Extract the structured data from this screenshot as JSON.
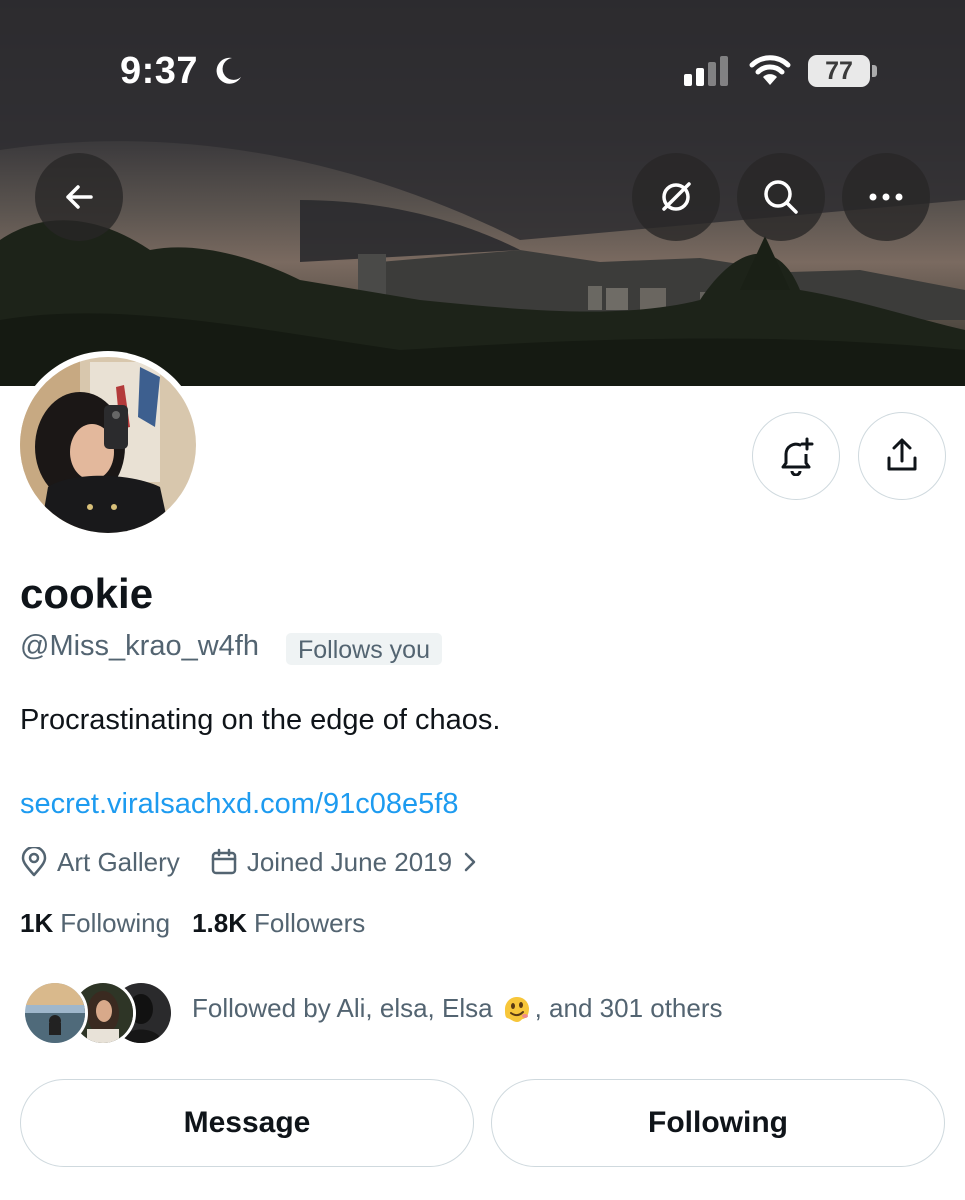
{
  "status_bar": {
    "time": "9:37",
    "battery": "77"
  },
  "header": {
    "icons": [
      "back-arrow-icon",
      "grok-icon",
      "search-icon",
      "more-icon"
    ]
  },
  "profile": {
    "display_name": "cookie",
    "handle": "@Miss_krao_w4fh",
    "follows_you_label": "Follows you",
    "bio": "Procrastinating on the edge of chaos.",
    "link": "secret.viralsachxd.com/91c08e5f8",
    "location": "Art Gallery",
    "joined": "Joined June 2019",
    "following_count": "1K",
    "following_label": "Following",
    "followers_count": "1.8K",
    "followers_label": "Followers",
    "followed_by_prefix": "Followed by Ali, elsa, Elsa",
    "followed_by_suffix": ", and 301 others"
  },
  "actions": {
    "message_label": "Message",
    "following_label": "Following"
  },
  "colors": {
    "accent_link": "#1d9bf0",
    "text_primary": "#0f1419",
    "text_secondary": "#536471",
    "border": "#cfd9de"
  }
}
